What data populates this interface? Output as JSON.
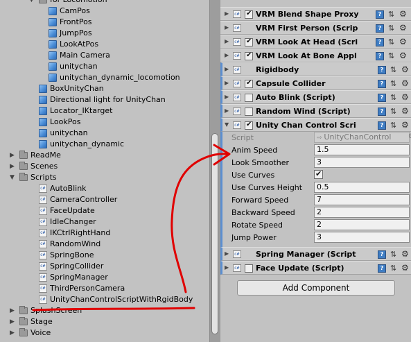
{
  "project": {
    "items": [
      {
        "label": "for Locomotion",
        "type": "folder",
        "depth": 3,
        "arrow": "▼"
      },
      {
        "label": "CamPos",
        "type": "prefab",
        "depth": 4
      },
      {
        "label": "FrontPos",
        "type": "prefab",
        "depth": 4
      },
      {
        "label": "JumpPos",
        "type": "prefab",
        "depth": 4
      },
      {
        "label": "LookAtPos",
        "type": "prefab",
        "depth": 4
      },
      {
        "label": "Main Camera",
        "type": "prefab",
        "depth": 4
      },
      {
        "label": "unitychan",
        "type": "prefab",
        "depth": 4
      },
      {
        "label": "unitychan_dynamic_locomotion",
        "type": "prefab",
        "depth": 4
      },
      {
        "label": "BoxUnityChan",
        "type": "prefab",
        "depth": 3
      },
      {
        "label": "Directional light for UnityChan",
        "type": "prefab",
        "depth": 3
      },
      {
        "label": "Locator_IKtarget",
        "type": "prefab",
        "depth": 3
      },
      {
        "label": "LookPos",
        "type": "prefab",
        "depth": 3
      },
      {
        "label": "unitychan",
        "type": "prefab",
        "depth": 3
      },
      {
        "label": "unitychan_dynamic",
        "type": "prefab",
        "depth": 3
      },
      {
        "label": "ReadMe",
        "type": "folder",
        "depth": 2,
        "arrow": "▶"
      },
      {
        "label": "Scenes",
        "type": "folder",
        "depth": 2,
        "arrow": "▶"
      },
      {
        "label": "Scripts",
        "type": "folder",
        "depth": 2,
        "arrow": "▼"
      },
      {
        "label": "AutoBlink",
        "type": "script",
        "depth": 3
      },
      {
        "label": "CameraController",
        "type": "script",
        "depth": 3
      },
      {
        "label": "FaceUpdate",
        "type": "script",
        "depth": 3
      },
      {
        "label": "IdleChanger",
        "type": "script",
        "depth": 3
      },
      {
        "label": "IKCtrlRightHand",
        "type": "script",
        "depth": 3
      },
      {
        "label": "RandomWind",
        "type": "script",
        "depth": 3
      },
      {
        "label": "SpringBone",
        "type": "script",
        "depth": 3
      },
      {
        "label": "SpringCollider",
        "type": "script",
        "depth": 3
      },
      {
        "label": "SpringManager",
        "type": "script",
        "depth": 3
      },
      {
        "label": "ThirdPersonCamera",
        "type": "script",
        "depth": 3
      },
      {
        "label": "UnityChanControlScriptWithRgidBody",
        "type": "script",
        "depth": 3
      },
      {
        "label": "SplashScreen",
        "type": "folder",
        "depth": 2,
        "arrow": "▶"
      },
      {
        "label": "Stage",
        "type": "folder",
        "depth": 2,
        "arrow": "▶"
      },
      {
        "label": "Voice",
        "type": "folder",
        "depth": 2,
        "arrow": "▶"
      }
    ]
  },
  "inspector": {
    "components": [
      {
        "title": "VRM Blend Shape Proxy",
        "checkbox": true,
        "checked": true,
        "icon": "cs-script-icon"
      },
      {
        "title": "VRM First Person (Scrip",
        "checkbox": false,
        "checked": false,
        "icon": "cs-script-icon"
      },
      {
        "title": "VRM Look At Head (Scri",
        "checkbox": true,
        "checked": true,
        "icon": "cs-script-icon"
      },
      {
        "title": "VRM Look At Bone Appl",
        "checkbox": true,
        "checked": true,
        "icon": "cs-script-icon"
      },
      {
        "title": "Rigidbody",
        "checkbox": false,
        "checked": false,
        "icon": "rigidbody-icon"
      },
      {
        "title": "Capsule Collider",
        "checkbox": true,
        "checked": true,
        "icon": "capsule-collider-icon"
      },
      {
        "title": "Auto Blink (Script)",
        "checkbox": true,
        "checked": false,
        "icon": "cs-script-icon"
      },
      {
        "title": "Random Wind (Script)",
        "checkbox": true,
        "checked": false,
        "icon": "cs-script-icon"
      },
      {
        "title": "Unity Chan Control Scri",
        "checkbox": true,
        "checked": true,
        "icon": "cs-script-icon"
      }
    ],
    "uccs": {
      "script_label": "Script",
      "script_value": "UnityChanControl",
      "properties": [
        {
          "label": "Anim Speed",
          "value": "1.5"
        },
        {
          "label": "Look Smoother",
          "value": "3"
        },
        {
          "label": "Use Curves",
          "value": "checkbox",
          "checked": true
        },
        {
          "label": "Use Curves Height",
          "value": "0.5"
        },
        {
          "label": "Forward Speed",
          "value": "7"
        },
        {
          "label": "Backward Speed",
          "value": "2"
        },
        {
          "label": "Rotate Speed",
          "value": "2"
        },
        {
          "label": "Jump Power",
          "value": "3"
        }
      ]
    },
    "bottom_components": [
      {
        "title": "Spring Manager (Script",
        "checkbox": false,
        "checked": false
      },
      {
        "title": "Face Update (Script)",
        "checkbox": true,
        "checked": false
      }
    ],
    "add_component_label": "Add Component",
    "colors": {
      "accent": "#5b8ed0",
      "annotation": "#e00000"
    }
  }
}
